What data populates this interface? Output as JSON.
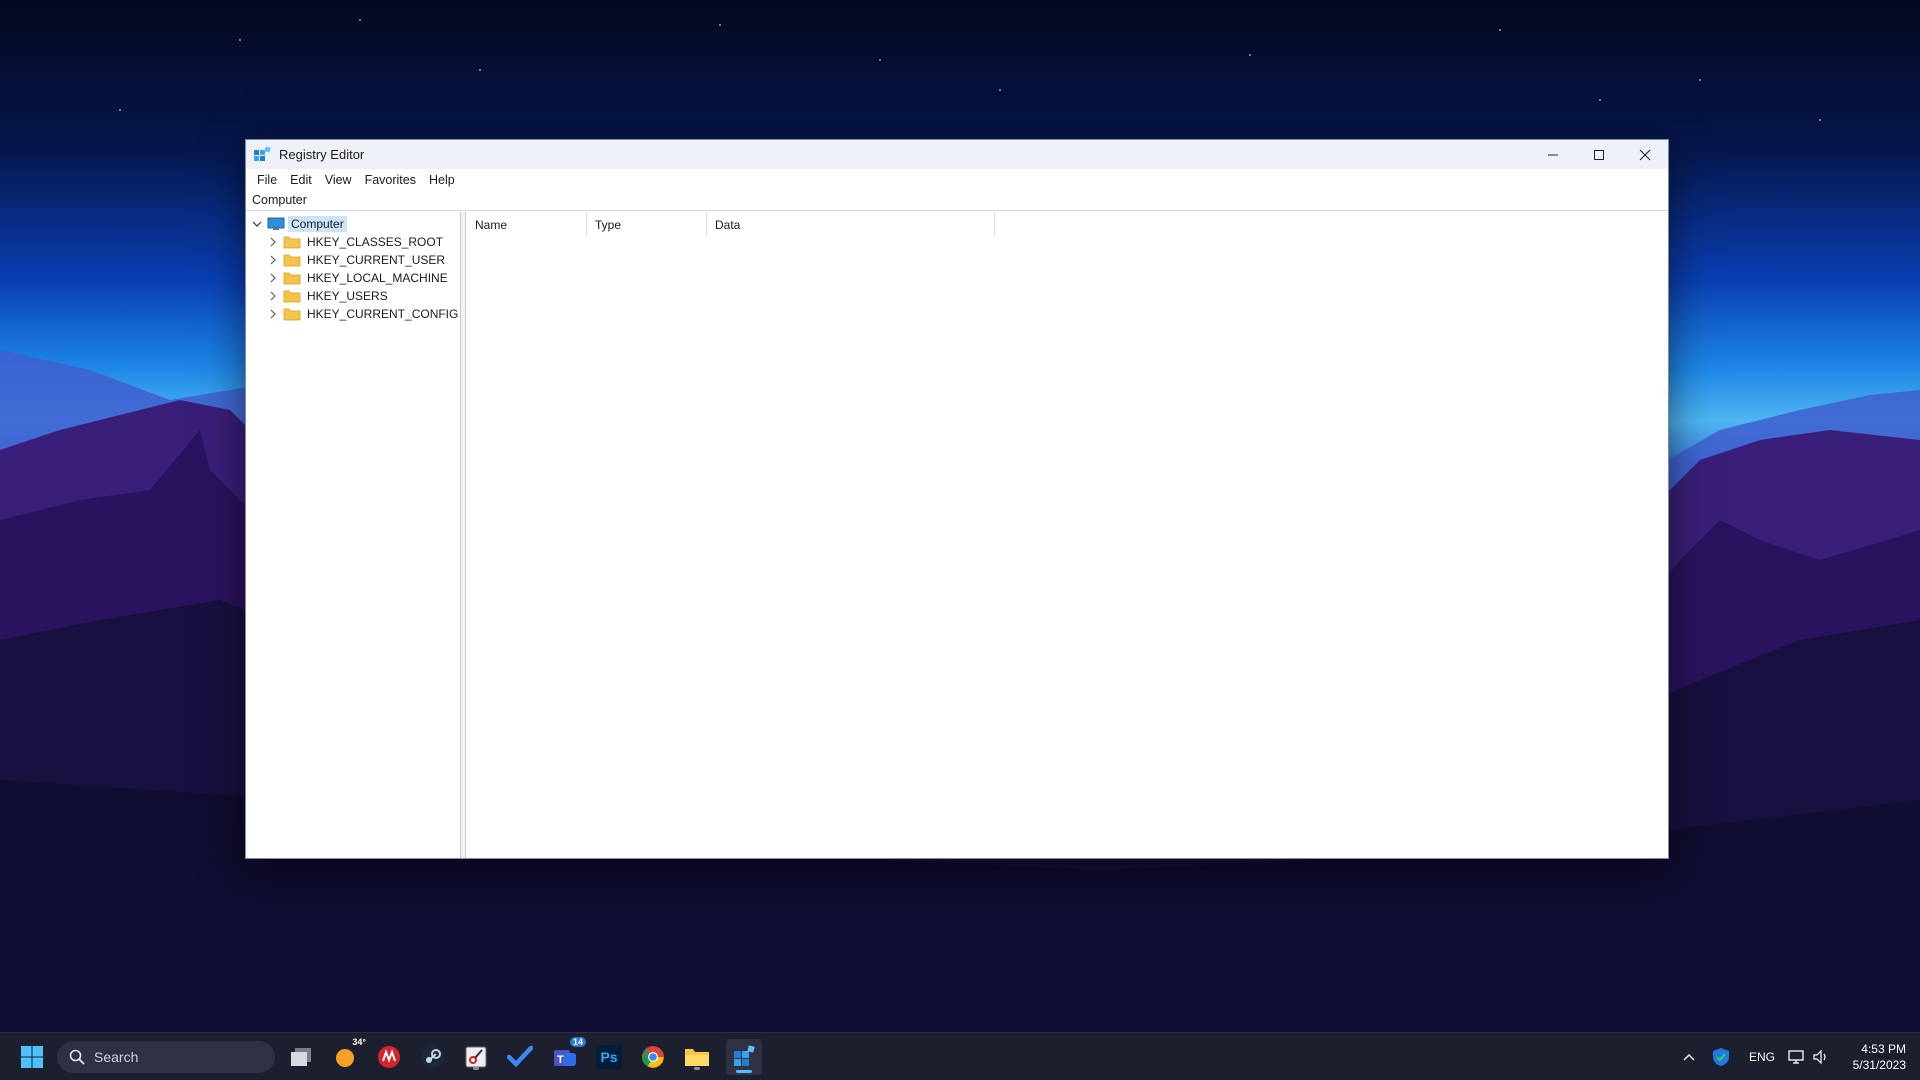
{
  "window": {
    "title": "Registry Editor",
    "menu": [
      "File",
      "Edit",
      "View",
      "Favorites",
      "Help"
    ],
    "address": "Computer",
    "tree": {
      "root": "Computer",
      "children": [
        "HKEY_CLASSES_ROOT",
        "HKEY_CURRENT_USER",
        "HKEY_LOCAL_MACHINE",
        "HKEY_USERS",
        "HKEY_CURRENT_CONFIG"
      ]
    },
    "columns": [
      "Name",
      "Type",
      "Data"
    ]
  },
  "taskbar": {
    "search_placeholder": "Search",
    "weather_temp": "34°",
    "notifications_count": "14",
    "photoshop_label": "Ps",
    "language": "ENG",
    "time": "4:53 PM",
    "date": "5/31/2023"
  },
  "icons": {
    "start": "windows-start-icon",
    "search": "search-icon",
    "task_view": "task-view-icon",
    "weather": "weather-icon",
    "apps": [
      "app-red-icon",
      "steam-icon",
      "snipping-tool-icon",
      "todo-icon",
      "teams-icon",
      "photoshop-icon",
      "chrome-icon",
      "file-explorer-icon",
      "registry-editor-icon"
    ]
  },
  "colors": {
    "selection": "#cce4f7",
    "accent": "#4cc2ff",
    "taskbar": "#1c1f2e"
  }
}
